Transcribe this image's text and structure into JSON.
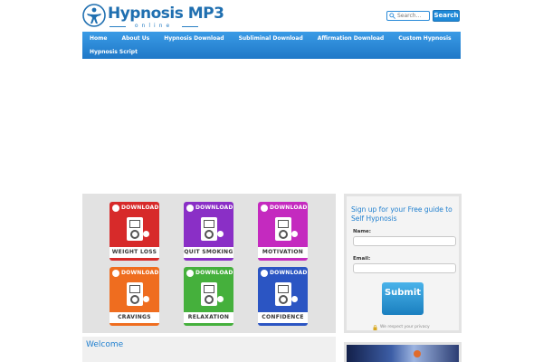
{
  "header": {
    "logo_title": "Hypnosis MP3",
    "logo_sub": "online",
    "search_placeholder": "Search...",
    "search_button": "Search"
  },
  "nav": {
    "items": [
      "Home",
      "About Us",
      "Hypnosis Download",
      "Subliminal Download",
      "Affirmation Download",
      "Custom Hypnosis",
      "Hypnosis Script"
    ]
  },
  "products": {
    "download_label": "DOWNLOAD",
    "tiles": [
      {
        "label": "WEIGHT LOSS",
        "color": "#d72a2a"
      },
      {
        "label": "QUIT SMOKING",
        "color": "#8a2fc6"
      },
      {
        "label": "MOTIVATION",
        "color": "#c42abf"
      },
      {
        "label": "CRAVINGS",
        "color": "#ef6d1f"
      },
      {
        "label": "RELAXATION",
        "color": "#45b03c"
      },
      {
        "label": "CONFIDENCE",
        "color": "#2b55c3"
      }
    ]
  },
  "signup": {
    "heading": "Sign up for your Free guide to Self Hypnosis",
    "name_label": "Name:",
    "email_label": "Email:",
    "submit_label": "Submit",
    "privacy_text": "We respect your privacy"
  },
  "welcome": {
    "title": "Welcome"
  },
  "colors": {
    "brand": "#1f6fb0",
    "nav": "#2a88d8",
    "accent": "#1f7fcf"
  }
}
